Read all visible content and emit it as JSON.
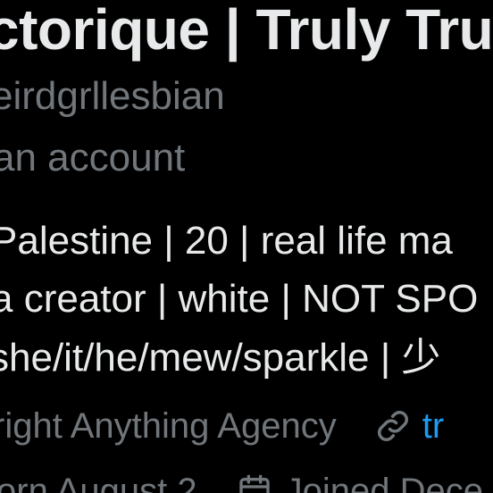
{
  "profile": {
    "display_name": "ctorique | Truly Tru",
    "handle": "eirdgrllesbian",
    "parody_label": "an account",
    "bio_line_1": "Palestine | 20 | real life ma",
    "bio_line_2": "a creator | white | NOT SPO",
    "bio_line_3": "she/it/he/mew/sparkle | 少",
    "location": "right Anything Agency",
    "link_text": "tr",
    "born": "orn August 2",
    "joined": "Joined Dece"
  },
  "colors": {
    "background": "#000000",
    "primary_text": "#e7e9ea",
    "secondary_text": "#71767b",
    "link": "#1d9bf0"
  },
  "icons": {
    "link": "link-icon",
    "calendar": "calendar-icon"
  }
}
